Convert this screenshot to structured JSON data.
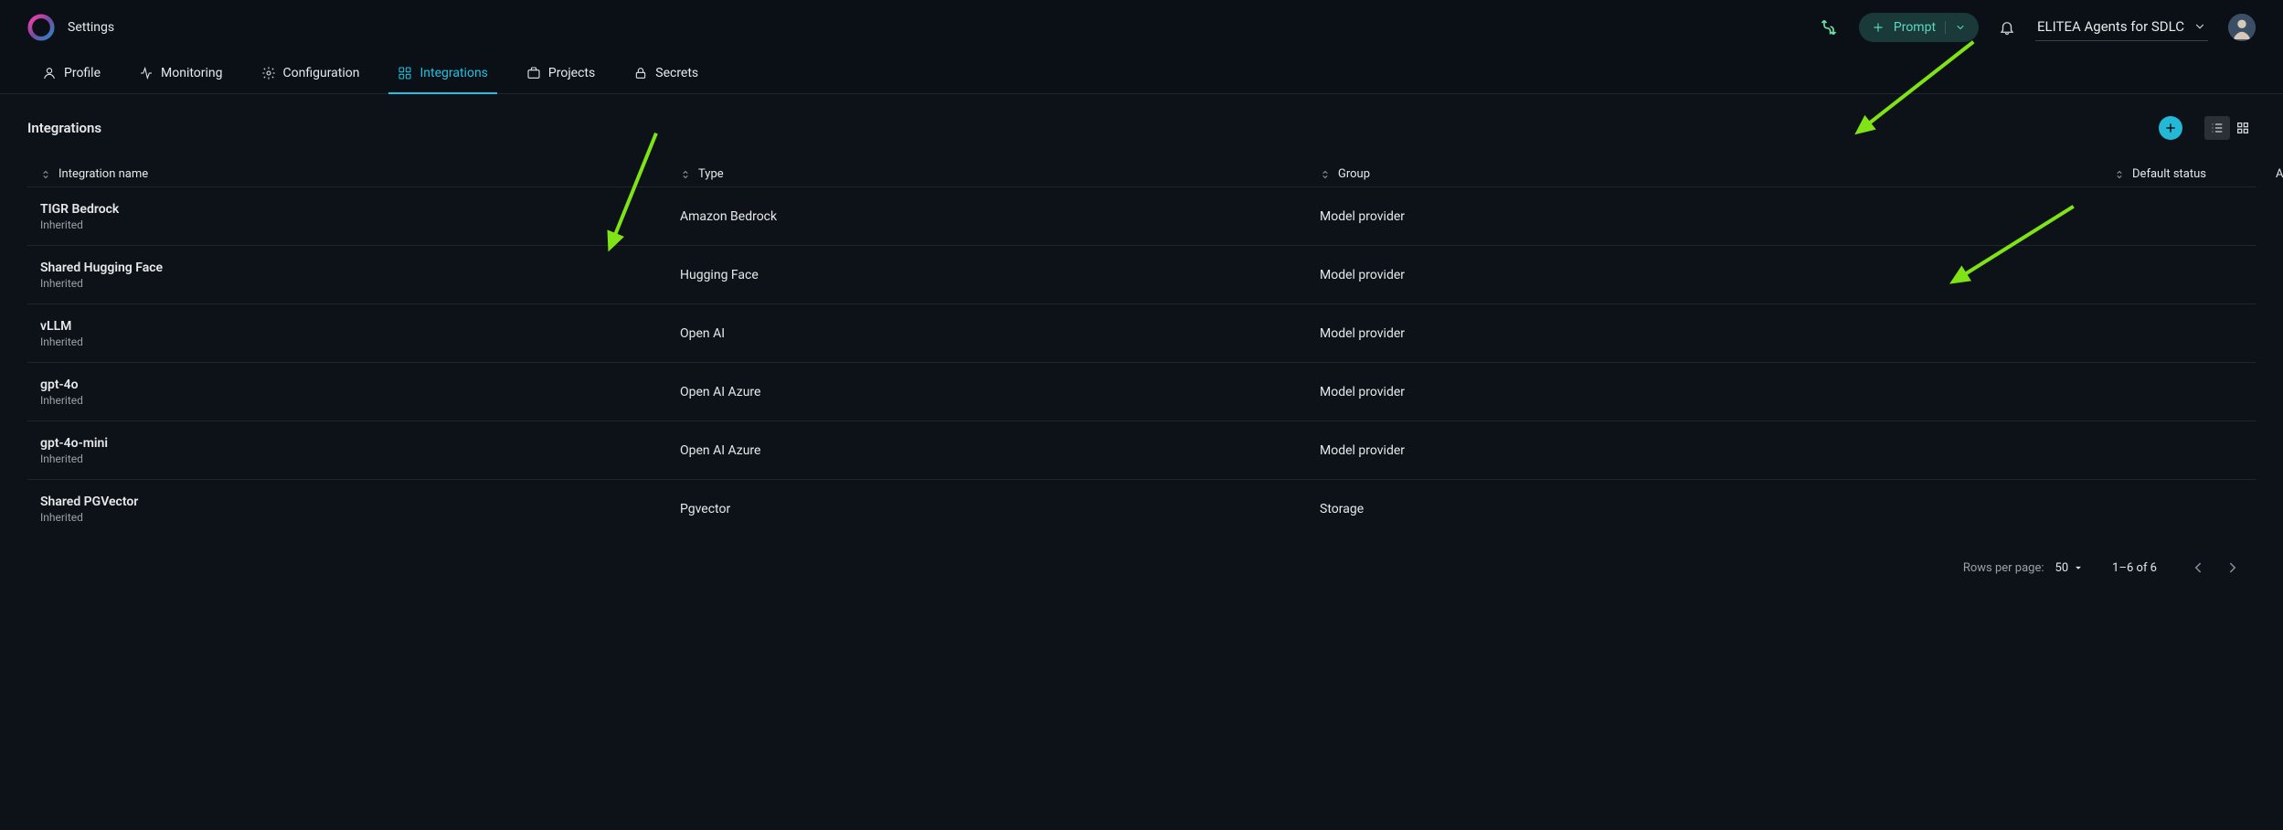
{
  "header": {
    "page_title": "Settings",
    "prompt_label": "Prompt",
    "workspace_label": "ELITEA Agents for SDLC"
  },
  "nav": {
    "items": [
      {
        "label": "Profile",
        "icon": "user-icon",
        "active": false
      },
      {
        "label": "Monitoring",
        "icon": "activity-icon",
        "active": false
      },
      {
        "label": "Configuration",
        "icon": "gear-icon",
        "active": false
      },
      {
        "label": "Integrations",
        "icon": "grid-icon",
        "active": true
      },
      {
        "label": "Projects",
        "icon": "briefcase-icon",
        "active": false
      },
      {
        "label": "Secrets",
        "icon": "lock-icon",
        "active": false
      }
    ]
  },
  "section": {
    "title": "Integrations"
  },
  "table": {
    "columns": {
      "name": "Integration name",
      "type": "Type",
      "group": "Group",
      "status": "Default status",
      "actions": "Actions"
    },
    "rows": [
      {
        "name": "TIGR Bedrock",
        "sub": "Inherited",
        "type": "Amazon Bedrock",
        "group": "Model provider",
        "status": ""
      },
      {
        "name": "Shared Hugging Face",
        "sub": "Inherited",
        "type": "Hugging Face",
        "group": "Model provider",
        "status": ""
      },
      {
        "name": "vLLM",
        "sub": "Inherited",
        "type": "Open AI",
        "group": "Model provider",
        "status": ""
      },
      {
        "name": "gpt-4o",
        "sub": "Inherited",
        "type": "Open AI Azure",
        "group": "Model provider",
        "status": ""
      },
      {
        "name": "gpt-4o-mini",
        "sub": "Inherited",
        "type": "Open AI Azure",
        "group": "Model provider",
        "status": ""
      },
      {
        "name": "Shared PGVector",
        "sub": "Inherited",
        "type": "Pgvector",
        "group": "Storage",
        "status": ""
      }
    ]
  },
  "pagination": {
    "rows_per_page_label": "Rows per page:",
    "rows_per_page_value": "50",
    "range_label": "1–6 of 6"
  }
}
